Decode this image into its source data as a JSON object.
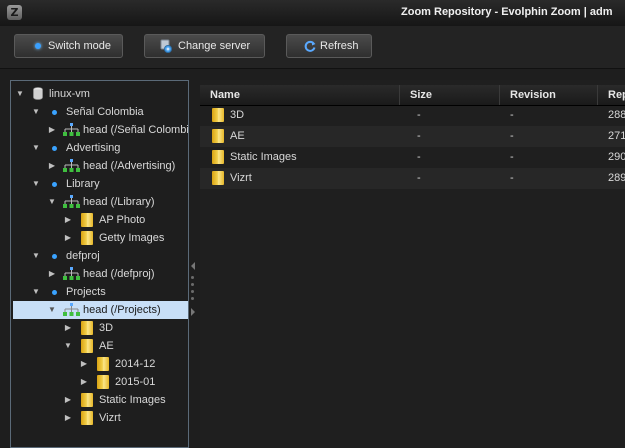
{
  "window": {
    "icon_glyph": "Z",
    "title": "Zoom Repository - Evolphin Zoom | adm"
  },
  "toolbar": {
    "switch_mode": "Switch mode",
    "change_server": "Change server",
    "refresh": "Refresh"
  },
  "tree": {
    "items": [
      {
        "label": "linux-vm",
        "icon": "database-icon",
        "expanded": true
      },
      {
        "label": "Señal Colombia",
        "icon": "bullet-icon",
        "expanded": true
      },
      {
        "label": "head (/Señal Colombia",
        "icon": "branch-icon",
        "expanded": false
      },
      {
        "label": "Advertising",
        "icon": "bullet-icon",
        "expanded": true
      },
      {
        "label": "head (/Advertising)",
        "icon": "branch-icon",
        "expanded": false
      },
      {
        "label": "Library",
        "icon": "bullet-icon",
        "expanded": true
      },
      {
        "label": "head (/Library)",
        "icon": "branch-icon",
        "expanded": true
      },
      {
        "label": "AP Photo",
        "icon": "folder-icon",
        "expanded": false
      },
      {
        "label": "Getty Images",
        "icon": "folder-icon",
        "expanded": false
      },
      {
        "label": "defproj",
        "icon": "bullet-icon",
        "expanded": true
      },
      {
        "label": "head (/defproj)",
        "icon": "branch-icon",
        "expanded": false
      },
      {
        "label": "Projects",
        "icon": "bullet-icon",
        "expanded": true
      },
      {
        "label": "head (/Projects)",
        "icon": "branch-icon",
        "expanded": true,
        "selected": true
      },
      {
        "label": "3D",
        "icon": "folder-icon",
        "expanded": false
      },
      {
        "label": "AE",
        "icon": "folder-icon",
        "expanded": true
      },
      {
        "label": "2014-12",
        "icon": "folder-icon",
        "expanded": false
      },
      {
        "label": "2015-01",
        "icon": "folder-icon",
        "expanded": false
      },
      {
        "label": "Static Images",
        "icon": "folder-icon",
        "expanded": false
      },
      {
        "label": "Vizrt",
        "icon": "folder-icon",
        "expanded": false
      }
    ]
  },
  "table": {
    "columns": [
      "Name",
      "Size",
      "Revision",
      "Rep"
    ],
    "rows": [
      {
        "name": "3D",
        "size": "-",
        "revision": "-",
        "rep": "288"
      },
      {
        "name": "AE",
        "size": "-",
        "revision": "-",
        "rep": "271"
      },
      {
        "name": "Static Images",
        "size": "-",
        "revision": "-",
        "rep": "290"
      },
      {
        "name": "Vizrt",
        "size": "-",
        "revision": "-",
        "rep": "289"
      }
    ]
  },
  "colors": {
    "accent": "#3aa3ff",
    "selection": "#c8dff7",
    "folder": "#f2cf4a",
    "background": "#1e1e1e"
  }
}
